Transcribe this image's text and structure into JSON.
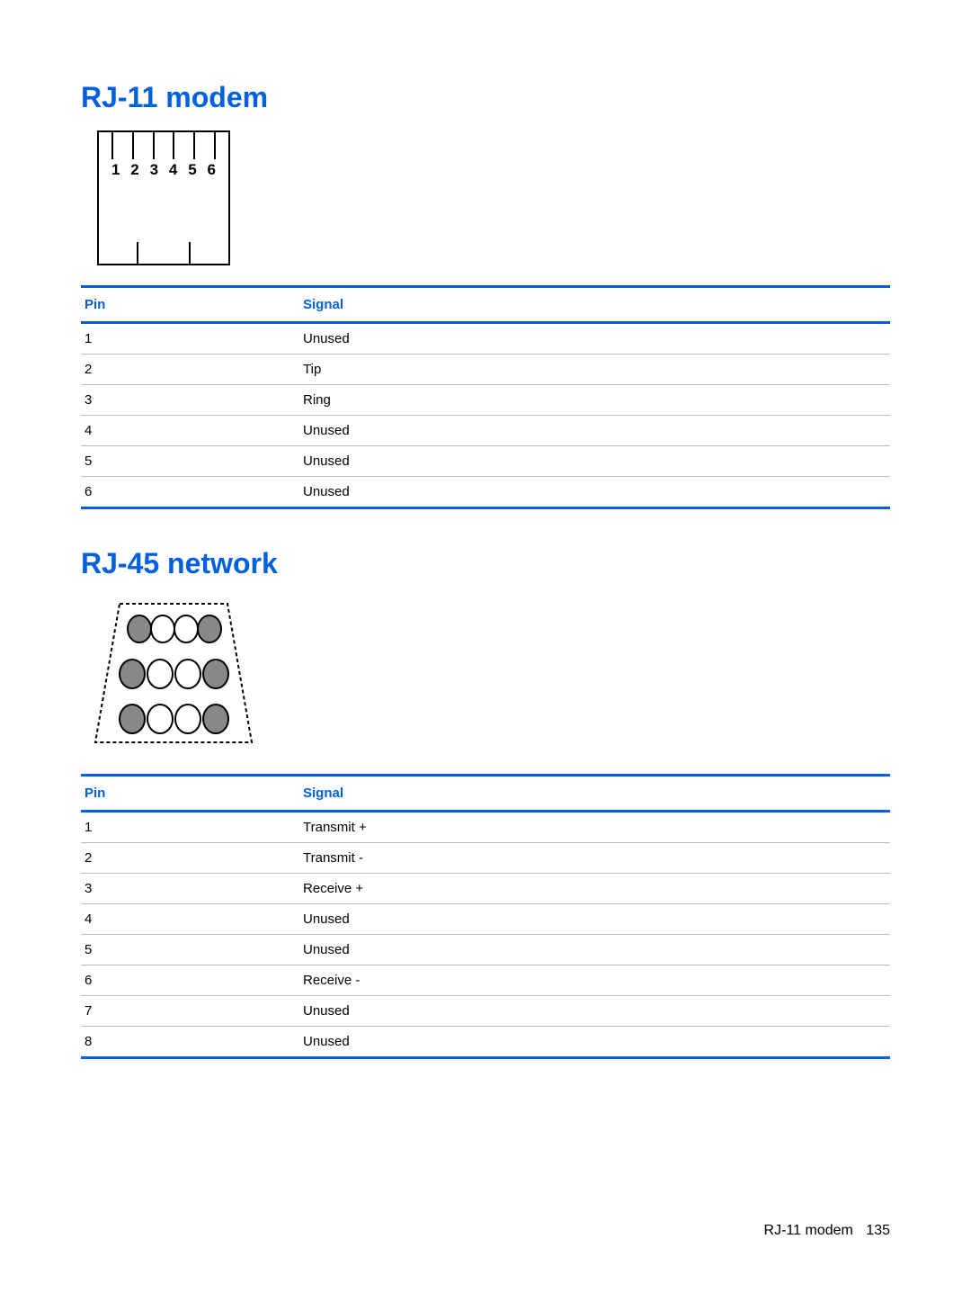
{
  "section1": {
    "title": "RJ-11 modem",
    "pin_labels": [
      "1",
      "2",
      "3",
      "4",
      "5",
      "6"
    ],
    "table": {
      "headers": {
        "pin": "Pin",
        "signal": "Signal"
      },
      "rows": [
        {
          "pin": "1",
          "signal": "Unused"
        },
        {
          "pin": "2",
          "signal": "Tip"
        },
        {
          "pin": "3",
          "signal": "Ring"
        },
        {
          "pin": "4",
          "signal": "Unused"
        },
        {
          "pin": "5",
          "signal": "Unused"
        },
        {
          "pin": "6",
          "signal": "Unused"
        }
      ]
    }
  },
  "section2": {
    "title": "RJ-45 network",
    "table": {
      "headers": {
        "pin": "Pin",
        "signal": "Signal"
      },
      "rows": [
        {
          "pin": "1",
          "signal": "Transmit +"
        },
        {
          "pin": "2",
          "signal": "Transmit -"
        },
        {
          "pin": "3",
          "signal": "Receive +"
        },
        {
          "pin": "4",
          "signal": "Unused"
        },
        {
          "pin": "5",
          "signal": "Unused"
        },
        {
          "pin": "6",
          "signal": "Receive -"
        },
        {
          "pin": "7",
          "signal": "Unused"
        },
        {
          "pin": "8",
          "signal": "Unused"
        }
      ]
    }
  },
  "footer": {
    "section_ref": "RJ-11 modem",
    "page_number": "135"
  }
}
